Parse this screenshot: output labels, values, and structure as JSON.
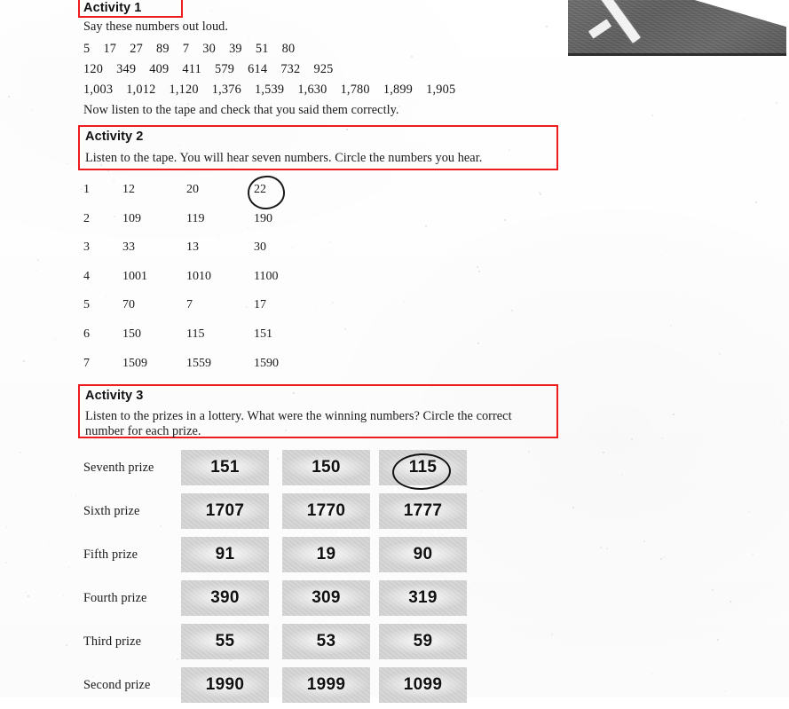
{
  "page": {
    "type": "worksheet-scan",
    "annotation_color": "#ee1c1c"
  },
  "photo": {
    "name": "cropped-photo-fragment",
    "description": "grayscale photo corner"
  },
  "activity1": {
    "title": "Activity 1",
    "instruction": "Say these numbers out loud.",
    "number_rows": [
      "5    17    27    89    7    30    39    51    80",
      "120    349    409    411    579    614    732    925",
      "1,003    1,012    1,120    1,376    1,539    1,630    1,780    1,899    1,905"
    ],
    "outro": "Now listen to the tape and check that you said them correctly."
  },
  "activity2": {
    "title": "Activity 2",
    "instruction": "Listen to the tape. You will hear seven numbers. Circle the numbers you hear.",
    "rows": [
      {
        "index": "1",
        "options": [
          "12",
          "20",
          "22"
        ]
      },
      {
        "index": "2",
        "options": [
          "109",
          "119",
          "190"
        ]
      },
      {
        "index": "3",
        "options": [
          "33",
          "13",
          "30"
        ]
      },
      {
        "index": "4",
        "options": [
          "1001",
          "1010",
          "1100"
        ]
      },
      {
        "index": "5",
        "options": [
          "70",
          "7",
          "17"
        ]
      },
      {
        "index": "6",
        "options": [
          "150",
          "115",
          "151"
        ]
      },
      {
        "index": "7",
        "options": [
          "1509",
          "1559",
          "1590"
        ]
      }
    ],
    "circled_answer": "22"
  },
  "activity3": {
    "title": "Activity 3",
    "instruction": "Listen to the prizes in a lottery. What were the winning numbers? Circle the correct number for each prize.",
    "rows": [
      {
        "label": "Seventh prize",
        "options": [
          "151",
          "150",
          "115"
        ]
      },
      {
        "label": "Sixth prize",
        "options": [
          "1707",
          "1770",
          "1777"
        ]
      },
      {
        "label": "Fifth prize",
        "options": [
          "91",
          "19",
          "90"
        ]
      },
      {
        "label": "Fourth prize",
        "options": [
          "390",
          "309",
          "319"
        ]
      },
      {
        "label": "Third prize",
        "options": [
          "55",
          "53",
          "59"
        ]
      },
      {
        "label": "Second prize",
        "options": [
          "1990",
          "1999",
          "1099"
        ]
      }
    ],
    "circled_answer": "115"
  }
}
